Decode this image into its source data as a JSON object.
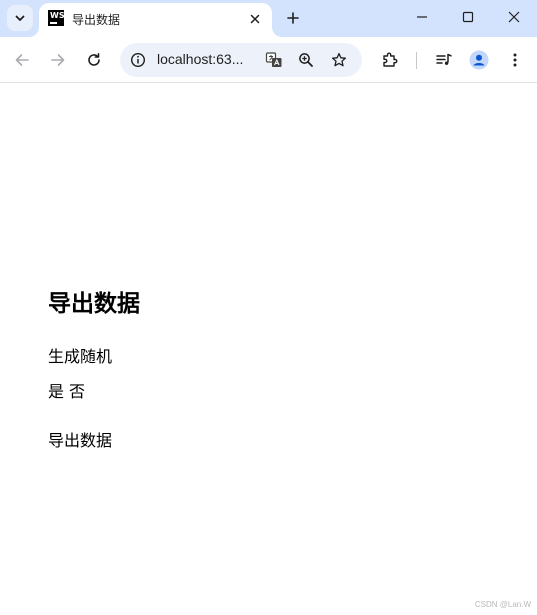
{
  "tab": {
    "title": "导出数据",
    "favicon_text": "WS"
  },
  "toolbar": {
    "url": "localhost:63..."
  },
  "page": {
    "heading": "导出数据",
    "generate_label": "生成随机",
    "option_yes": "是",
    "option_no": "否",
    "export_label": "导出数据"
  },
  "watermark": "CSDN @Lan.W",
  "colors": {
    "tabstrip": "#d3e3fd",
    "omnibox": "#edf2fa",
    "profile": "#0b57d0"
  }
}
